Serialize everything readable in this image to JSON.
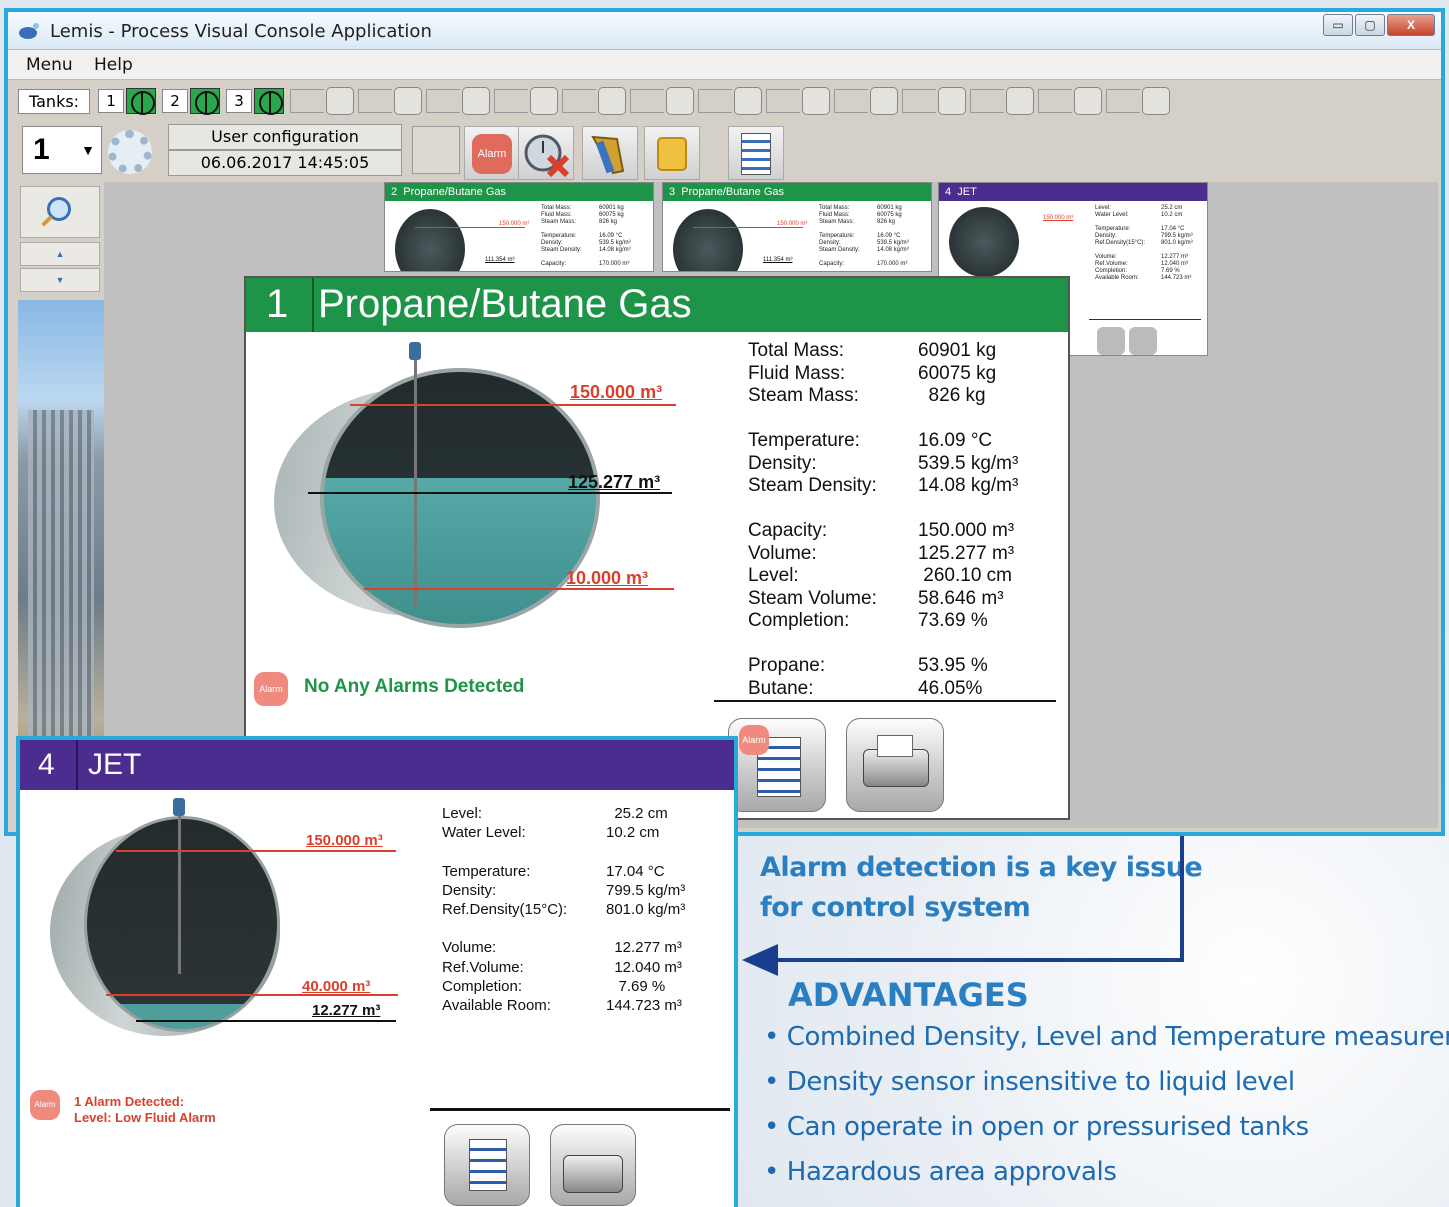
{
  "window": {
    "title": "Lemis - Process Visual Console Application",
    "controls": {
      "minimize": "▭",
      "maximize": "▢",
      "close": "X"
    }
  },
  "menu": {
    "items": [
      "Menu",
      "Help"
    ]
  },
  "tanks_bar": {
    "label": "Tanks:",
    "tanks": [
      "1",
      "2",
      "3"
    ]
  },
  "toolbar": {
    "selected_tank": "1",
    "config_label": "User configuration",
    "datetime": "06.06.2017 14:45:05",
    "alarm_icon_label": "Alarm"
  },
  "mini_cards": [
    {
      "num": "2",
      "title": "Propane/Butane Gas",
      "level_label": "150.000 m³",
      "volume_label": "111.354 m³",
      "labels": "Total Mass:\nFluid Mass:\nSteam Mass:\n\nTemperature:\nDensity:\nSteam Density:\n\nCapacity:",
      "values": "60901 kg\n60075 kg\n826 kg\n\n16.09 °C\n539.5 kg/m³\n14.08 kg/m³\n\n170.000 m³"
    },
    {
      "num": "3",
      "title": "Propane/Butane Gas",
      "level_label": "150.000 m³",
      "volume_label": "111.354 m³",
      "labels": "Total Mass:\nFluid Mass:\nSteam Mass:\n\nTemperature:\nDensity:\nSteam Density:\n\nCapacity:",
      "values": "60901 kg\n60075 kg\n826 kg\n\n16.09 °C\n539.5 kg/m³\n14.08 kg/m³\n\n170.000 m³"
    },
    {
      "num": "4",
      "title": "JET",
      "level_label": "150.000 m³",
      "labels": "Level:\nWater Level:\n\nTemperature:\nDensity:\nRef.Density(15°C):\n\nVolume:\nRef.Volume:\nCompletion:\nAvailable Room:",
      "values": "25.2 cm\n10.2 cm\n\n17.04 °C\n799.5 kg/m³\n801.0 kg/m³\n\n12.277 m³\n12.040 m³\n7.69 %\n144.723 m³"
    }
  ],
  "card1": {
    "num": "1",
    "title": "Propane/Butane Gas",
    "levels": {
      "top": "150.000 m³",
      "current": "125.277 m³",
      "low": "10.000 m³"
    },
    "labels": "Total Mass:\nFluid Mass:\nSteam Mass:\n\nTemperature:\nDensity:\nSteam Density:\n\nCapacity:\nVolume:\nLevel:\nSteam Volume:\nCompletion:\n\nPropane:\nButane:",
    "values": "60901 kg\n60075 kg\n  826 kg\n\n16.09 °C\n539.5 kg/m³\n14.08 kg/m³\n\n150.000 m³\n125.277 m³\n 260.10 cm\n58.646 m³\n73.69 %\n\n53.95 %\n46.05%",
    "alarm_status": "No Any Alarms Detected"
  },
  "card4": {
    "num": "4",
    "title": "JET",
    "levels": {
      "top": "150.000 m³",
      "alarm": "40.000 m³",
      "current": "12.277 m³"
    },
    "labels": "Level:\nWater Level:\n\nTemperature:\nDensity:\nRef.Density(15°C):\n\nVolume:\nRef.Volume:\nCompletion:\nAvailable Room:",
    "values": "  25.2 cm\n10.2 cm\n\n17.04 °C\n799.5 kg/m³\n801.0 kg/m³\n\n  12.277 m³\n  12.040 m³\n   7.69 %\n144.723 m³",
    "alarm_line1": "1 Alarm Detected:",
    "alarm_line2": "Level: Low Fluid Alarm"
  },
  "marketing": {
    "line1": "Alarm detection is a key issue",
    "line2": "for control system",
    "heading": "ADVANTAGES",
    "bullets": [
      "• Combined Density, Level and Temperature measuremen",
      "• Density sensor insensitive to liquid level",
      "• Can operate in open or pressurised tanks",
      "• Hazardous area approvals"
    ]
  },
  "colors": {
    "accent": "#29a8dc",
    "green": "#1e9448",
    "purple": "#4b2d8f",
    "alarm_red": "#d9412e",
    "text_blue": "#2a7fc2"
  }
}
